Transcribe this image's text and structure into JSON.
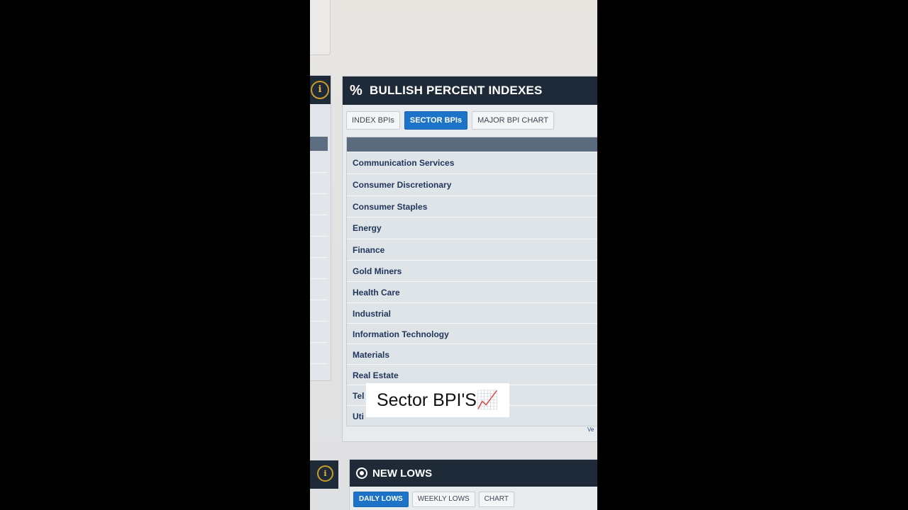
{
  "left_column": {
    "arrow_glyph": "➔",
    "info_glyph": "i"
  },
  "bpi_panel": {
    "icon_glyph": "%",
    "title": "BULLISH PERCENT INDEXES",
    "tabs": [
      {
        "label": "INDEX BPIs",
        "active": false
      },
      {
        "label": "SECTOR BPIs",
        "active": true
      },
      {
        "label": "MAJOR BPI CHART",
        "active": false
      }
    ],
    "rows": [
      "Communication Services",
      "Consumer Discretionary",
      "Consumer Staples",
      "Energy",
      "Finance",
      "Gold Miners",
      "Health Care",
      "Industrial",
      "Information Technology",
      "Materials",
      "Real Estate",
      "Tel",
      "Uti"
    ],
    "more_link": "Ve"
  },
  "lows_panel": {
    "title": "NEW LOWS",
    "tabs": [
      {
        "label": "DAILY LOWS",
        "active": true
      },
      {
        "label": "WEEKLY LOWS",
        "active": false
      },
      {
        "label": "CHART",
        "active": false
      }
    ]
  },
  "caption": {
    "text": "Sector BPI'S📈"
  }
}
